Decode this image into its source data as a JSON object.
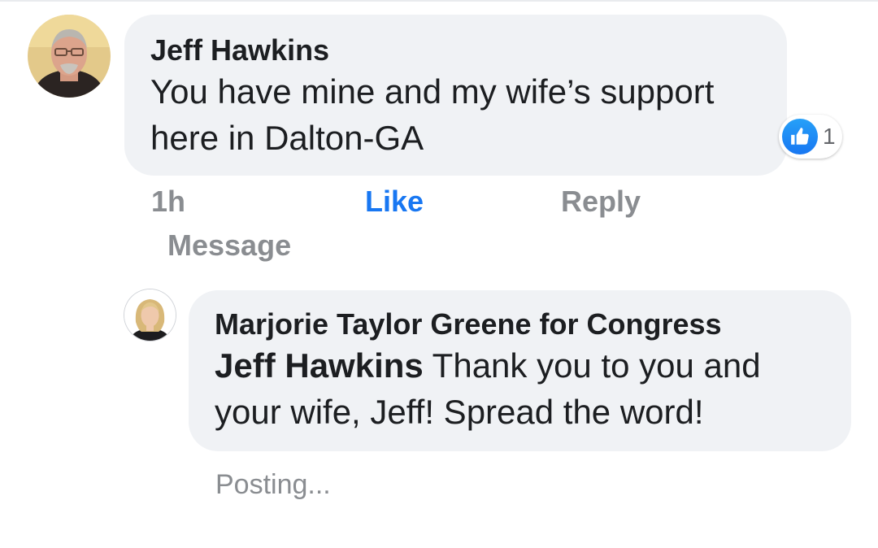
{
  "comment": {
    "author": "Jeff Hawkins",
    "text": "You have mine and my wife’s support here in Dalton-GA",
    "reaction": {
      "icon": "thumbs-up-icon",
      "count": "1",
      "color": "#1877f2"
    },
    "timestamp": "1h",
    "actions": {
      "like": "Like",
      "reply": "Reply",
      "message": "Message"
    }
  },
  "reply": {
    "author": "Marjorie Taylor Greene for Congress",
    "mention": "Jeff Hawkins",
    "text": " Thank you to you and your wife, Jeff! Spread the word!",
    "status": "Posting..."
  },
  "colors": {
    "bubble": "#f0f2f5",
    "accent": "#1877f2",
    "muted": "#8a8d91"
  }
}
